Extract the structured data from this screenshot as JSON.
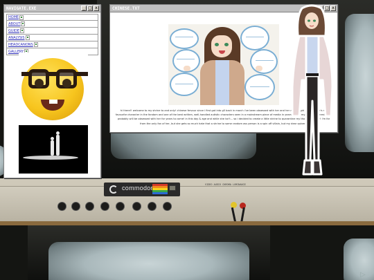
{
  "windows": {
    "navigate": {
      "title": "NAVIGATE.EXE",
      "links": [
        {
          "label": "HOME"
        },
        {
          "label": "ABOUT"
        },
        {
          "label": "GUIDE"
        },
        {
          "label": "ANALYSIS"
        },
        {
          "label": "HEADCANONS"
        },
        {
          "label": "GALLERY"
        }
      ],
      "images": [
        {
          "icon": "nerd-face-emoji-image"
        },
        {
          "icon": "silhouette-couple-image"
        }
      ]
    },
    "chinese": {
      "title": "CHINESE.TXT",
      "illustration": "anime-girl-illustration",
      "body": "hi there!! welcome to my shrine to and only! chinese fervour since i first got into g5 back in march i've been obsessed with her and her autistic girl wiggles. she's my favourite character in the fandom and one of the best written, well-handled autistic characters seen in a mainstream piece of media in years. she is my special interest and i probably will be obsessed with her for years to come! in this day & age and while she isn't... so i decided to create a little shrine to quarantine my thoughts of her! i'm far from the only fan of her, but she gets so much hate that a shrine to some random ass person is a spin off villain, but my dear quivers."
    }
  },
  "window_buttons": {
    "minimize": "_",
    "maximize": "□",
    "close": "x"
  },
  "backdrop": {
    "brand": "commodore",
    "play_glyph": "▷",
    "plate_text": "VIDEO AUDIO CHROMA LUMINANCE"
  },
  "colors": {
    "link": "#2b2bb8",
    "titlebar": "#c0c0c0",
    "window_bg": "#ffffff",
    "blob_border": "#7aaed4"
  }
}
